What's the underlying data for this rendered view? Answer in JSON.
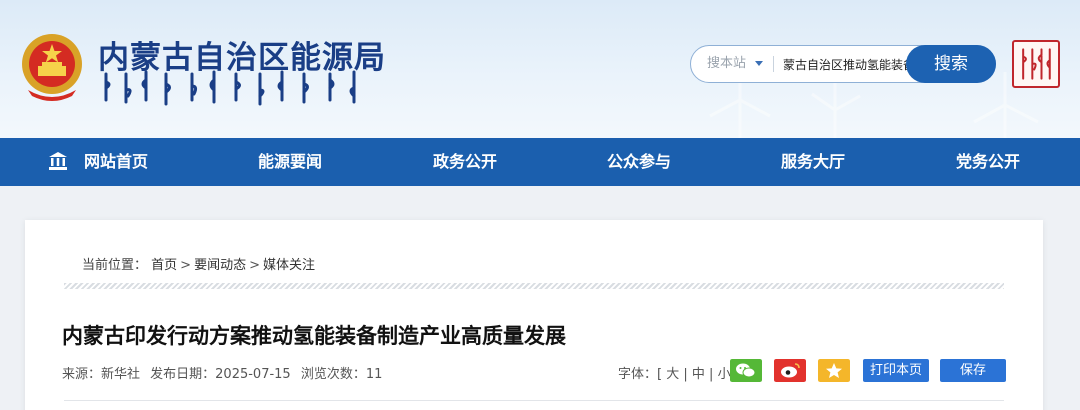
{
  "header": {
    "site_title": "内蒙古自治区能源局",
    "mongolian_title": "ᠦᠪᠦᠷ ᠮᠤᠩᠭᠤᠯ ᠤᠨ ᠡᠩᠷᠭᠢ",
    "search": {
      "scope": "搜本站",
      "query": "蒙古自治区推动氢能装备",
      "button": "搜索"
    }
  },
  "nav": {
    "items": [
      "网站首页",
      "能源要闻",
      "政务公开",
      "公众参与",
      "服务大厅",
      "党务公开"
    ]
  },
  "breadcrumb": {
    "prefix": "当前位置：",
    "items": [
      "首页",
      "要闻动态",
      "媒体关注"
    ]
  },
  "article": {
    "title": "内蒙古印发行动方案推动氢能装备制造产业高质量发展",
    "source": "来源：新华社",
    "date": "发布日期：2025-07-15",
    "views": "浏览次数：11",
    "fontsize_label": "字体：",
    "fontsize_options": [
      "大",
      "中",
      "小"
    ],
    "print_label": "打印本页",
    "save_label": "保存"
  },
  "colors": {
    "nav_bg": "#1b5fae",
    "title_blue": "#1a3e86",
    "wechat": "#55b837",
    "weibo": "#e2322d",
    "favorite": "#f4b62a",
    "button_blue": "#2b73d6"
  },
  "icons": [
    "national-emblem-icon",
    "home-icon",
    "wechat-icon",
    "weibo-icon",
    "star-icon",
    "seal-icon"
  ]
}
